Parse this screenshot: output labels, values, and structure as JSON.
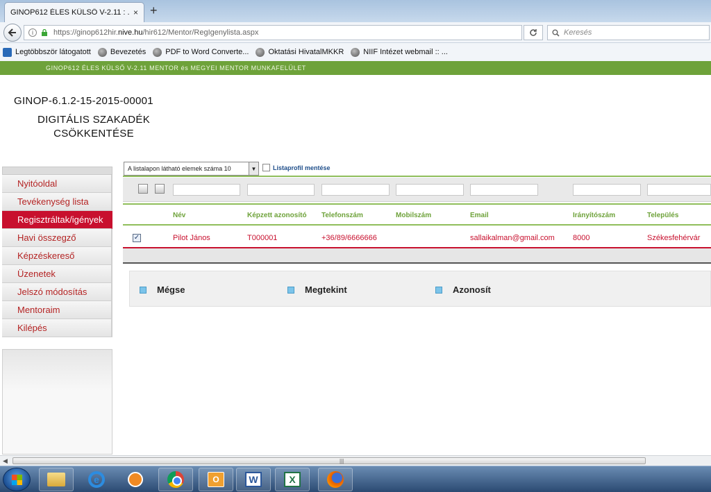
{
  "browser": {
    "tab_title": "GINOP612 ÉLES KÜLSŐ V-2.11 : ...",
    "tab_close": "×",
    "new_tab": "+",
    "url_prefix": "https://ginop612hir.",
    "url_host": "nive.hu",
    "url_path": "/hir612/Mentor/RegIgenylista.aspx",
    "search_placeholder": "Keresés",
    "bookmarks": [
      {
        "label": "Legtöbbször látogatott"
      },
      {
        "label": "Bevezetés"
      },
      {
        "label": "PDF to Word Converte..."
      },
      {
        "label": "Oktatási HivatalMKKR"
      },
      {
        "label": "NIIF Intézet webmail :: ..."
      }
    ]
  },
  "page": {
    "banner": "GINOP612 ÉLES KÜLSŐ V-2.11 MENTOR és MEGYEI MENTOR MUNKAFELÜLET",
    "project_code": "GINOP-6.1.2-15-2015-00001",
    "project_title_line1": "DIGITÁLIS SZAKADÉK",
    "project_title_line2": "CSÖKKENTÉSE"
  },
  "sidebar": {
    "items": [
      {
        "label": "Nyitóoldal"
      },
      {
        "label": "Tevékenység lista"
      },
      {
        "label": "Regisztráltak/igények"
      },
      {
        "label": "Havi összegző"
      },
      {
        "label": "Képzéskereső"
      },
      {
        "label": "Üzenetek"
      },
      {
        "label": "Jelszó módosítás"
      },
      {
        "label": "Mentoraim"
      },
      {
        "label": "Kilépés"
      }
    ],
    "active_index": 2
  },
  "list": {
    "page_size_label": "A listalapon látható elemek száma 10",
    "save_profile_label": "Listaprofil mentése",
    "columns": [
      "Név",
      "Képzett azonosító",
      "Telefonszám",
      "Mobilszám",
      "Email",
      "Irányítószám",
      "Település"
    ],
    "rows": [
      {
        "checked": true,
        "name": "Pilot János",
        "trainee_id": "T000001",
        "phone": "+36/89/6666666",
        "mobile": "",
        "email": "sallaikalman@gmail.com",
        "zip": "8000",
        "city": "Székesfehérvár"
      }
    ]
  },
  "actions": {
    "cancel": "Mégse",
    "view": "Megtekint",
    "identify": "Azonosít"
  },
  "colors": {
    "accent_green": "#6ea23a",
    "accent_red": "#c8102e",
    "link_blue": "#1f4e8a"
  },
  "taskbar": {
    "icons": [
      "windows-start-icon",
      "file-explorer-icon",
      "internet-explorer-icon",
      "media-player-icon",
      "chrome-icon",
      "outlook-icon",
      "word-icon",
      "excel-icon",
      "firefox-icon"
    ]
  }
}
